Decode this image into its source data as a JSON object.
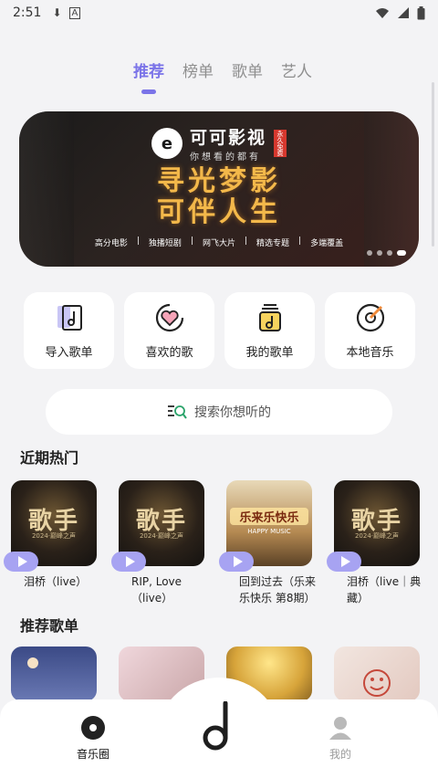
{
  "status": {
    "time": "2:51",
    "download_icon": "download-icon",
    "a_icon": "A"
  },
  "tabs": [
    {
      "label": "推荐",
      "active": true
    },
    {
      "label": "榜单",
      "active": false
    },
    {
      "label": "歌单",
      "active": false
    },
    {
      "label": "艺人",
      "active": false
    }
  ],
  "banner": {
    "brand_name": "可可影视",
    "brand_sub": "你想看的都有",
    "brand_tag": "永久免费",
    "slogan_line1": "寻光梦影",
    "slogan_line2": "可伴人生",
    "features": [
      "高分电影",
      "独播短剧",
      "网飞大片",
      "精选专题",
      "多端覆盖"
    ],
    "slide_count": 4,
    "active_slide": 0
  },
  "quick_actions": [
    {
      "label": "导入歌单",
      "icon": "import-playlist-icon"
    },
    {
      "label": "喜欢的歌",
      "icon": "favorite-heart-icon"
    },
    {
      "label": "我的歌单",
      "icon": "my-playlist-icon"
    },
    {
      "label": "本地音乐",
      "icon": "local-music-disc-icon"
    }
  ],
  "search": {
    "placeholder": "搜索你想听的"
  },
  "sections": {
    "recent_hot": "近期热门",
    "recommended_playlists": "推荐歌单"
  },
  "recent_hot": [
    {
      "title": "泪桥（live）",
      "cover_text": "歌手",
      "cover_sub": "2024·巅峰之声"
    },
    {
      "title": "RIP, Love（live）",
      "cover_text": "歌手",
      "cover_sub": "2024·巅峰之声"
    },
    {
      "title": "回到过去（乐来乐快乐 第8期）",
      "cover_text": "乐来乐快乐",
      "cover_sub": "HAPPY MUSIC"
    },
    {
      "title": "泪桥（live｜典藏）",
      "cover_text": "歌手",
      "cover_sub": "2024·巅峰之声"
    }
  ],
  "bottom_nav": {
    "home_label": "音乐圈",
    "mine_label": "我的",
    "center_icon": "music-note-icon"
  },
  "colors": {
    "accent": "#7b74e8",
    "play_badge": "#a7a3f2",
    "background": "#f3f3f5"
  }
}
